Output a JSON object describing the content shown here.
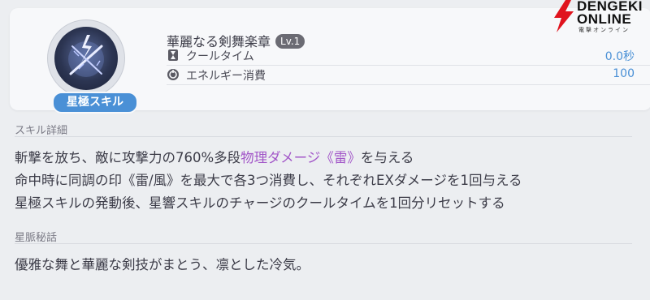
{
  "skill": {
    "name": "華麗なる剣舞楽章",
    "level": "Lv.1",
    "type_badge": "星極スキル",
    "icon": "lightning-sword-icon"
  },
  "stats": [
    {
      "label": "クールタイム",
      "value": "0.0秒",
      "icon": "hourglass-icon"
    },
    {
      "label": "エネルギー消費",
      "value": "100",
      "icon": "energy-icon"
    }
  ],
  "details": {
    "heading": "スキル詳細",
    "line1": {
      "pre": "斬撃を放ち、敵に攻撃力の760%多段",
      "highlight": "物理ダメージ《雷》",
      "post": "を与える"
    },
    "line2": "命中時に同調の印《雷/風》を最大で各3つ消費し、それぞれEXダメージを1回与える",
    "line3": "星極スキルの発動後、星響スキルのチャージのクールタイムを1回分リセットする"
  },
  "lore": {
    "heading": "星脈秘話",
    "text": "優雅な舞と華麗な剣技がまとう、凛とした冷気。"
  },
  "watermark": {
    "line1": "DENGEKI",
    "line2": "ONLINE",
    "sub": "電撃オンライン"
  },
  "colors": {
    "accent_blue": "#4a90d6",
    "highlight_purple": "#a256c8",
    "logo_red": "#e0141e"
  }
}
